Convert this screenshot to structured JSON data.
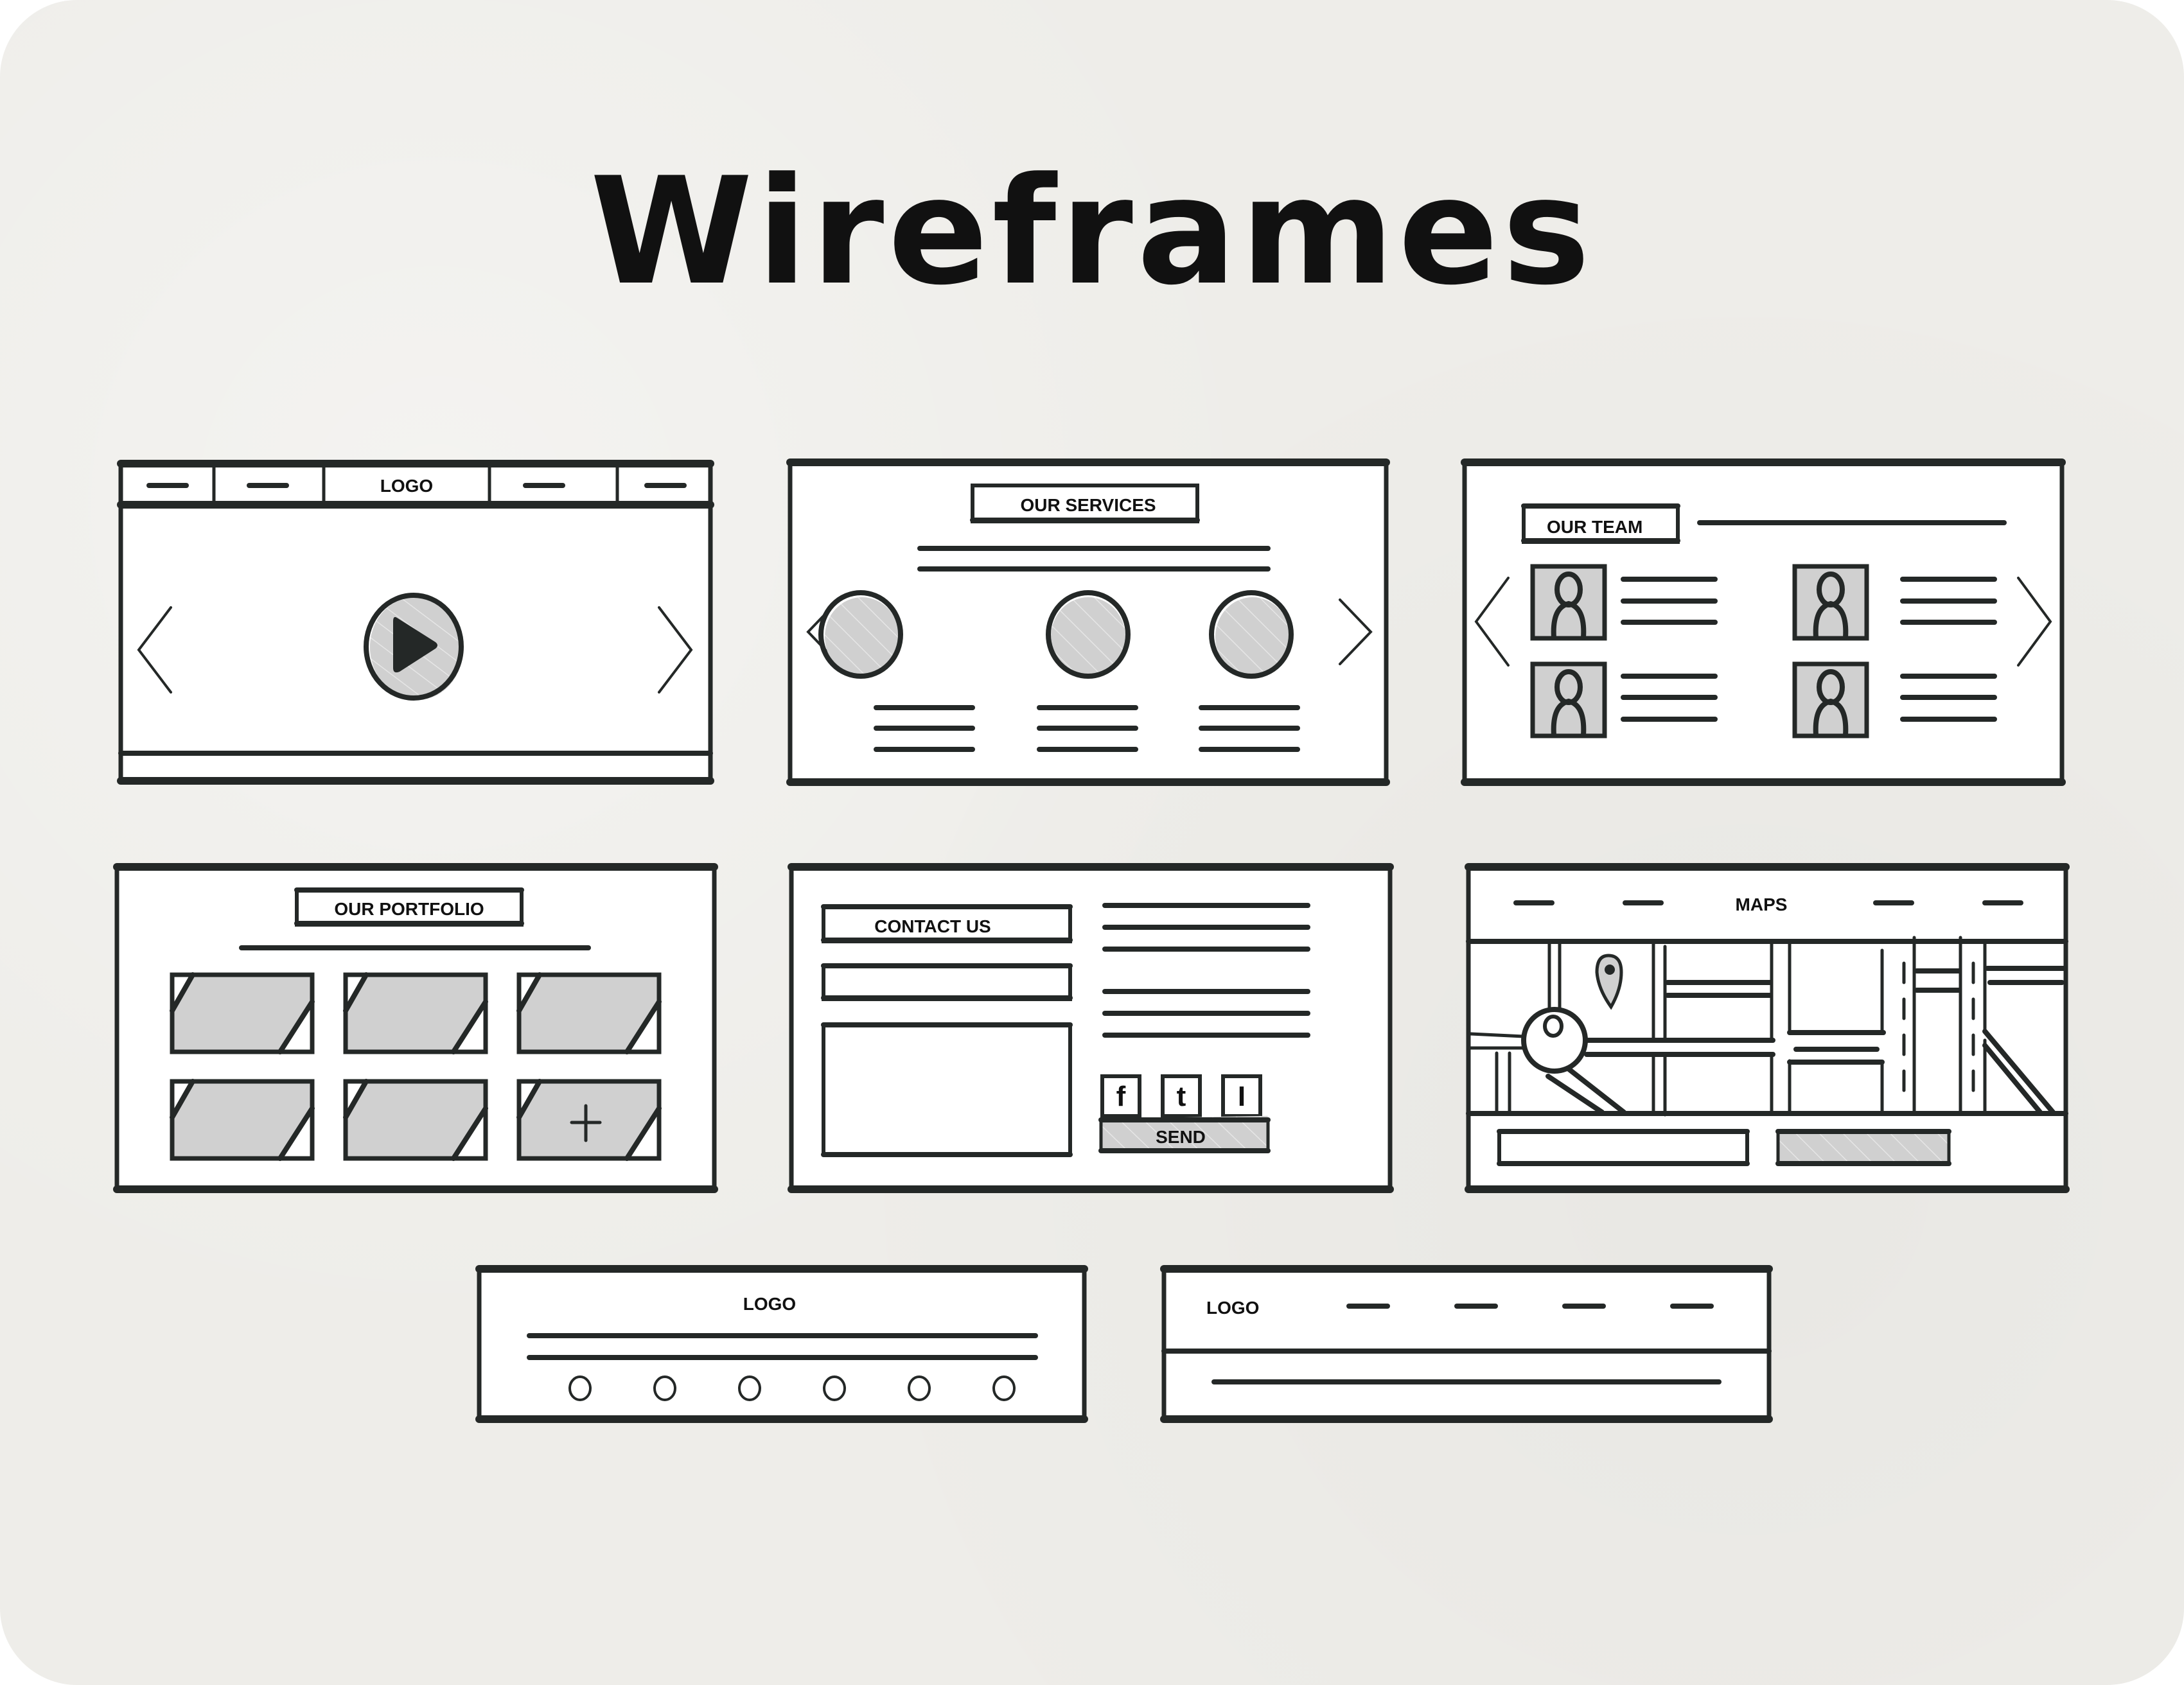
{
  "title": "Wireframes",
  "colors": {
    "background": "#eeede9",
    "ink": "#242827",
    "shade": "#d0d0d0",
    "panel": "#ffffff"
  },
  "panels": {
    "hero": {
      "logo": "LOGO",
      "nav_items": 4,
      "icons": [
        "chevron-left-icon",
        "play-icon",
        "chevron-right-icon"
      ]
    },
    "services": {
      "heading": "OUR SERVICES",
      "items": 3,
      "icons": [
        "chevron-left-icon",
        "chevron-right-icon"
      ]
    },
    "team": {
      "heading": "OUR TEAM",
      "members": 4,
      "icons": [
        "chevron-left-icon",
        "person-icon",
        "chevron-right-icon"
      ]
    },
    "portfolio": {
      "heading": "OUR PORTFOLIO",
      "tiles": 6,
      "icons": [
        "image-placeholder-icon",
        "plus-icon"
      ]
    },
    "contact": {
      "heading": "CONTACT US",
      "send_label": "SEND",
      "social": [
        {
          "name": "facebook",
          "glyph": "f"
        },
        {
          "name": "twitter",
          "glyph": "t"
        },
        {
          "name": "instagram",
          "glyph": "I"
        }
      ]
    },
    "maps": {
      "heading": "MAPS",
      "icons": [
        "map-pin-icon",
        "roundabout-icon"
      ]
    },
    "footer_centered": {
      "logo": "LOGO",
      "social_dots": 6
    },
    "footer_inline": {
      "logo": "LOGO",
      "nav_items": 4
    }
  }
}
